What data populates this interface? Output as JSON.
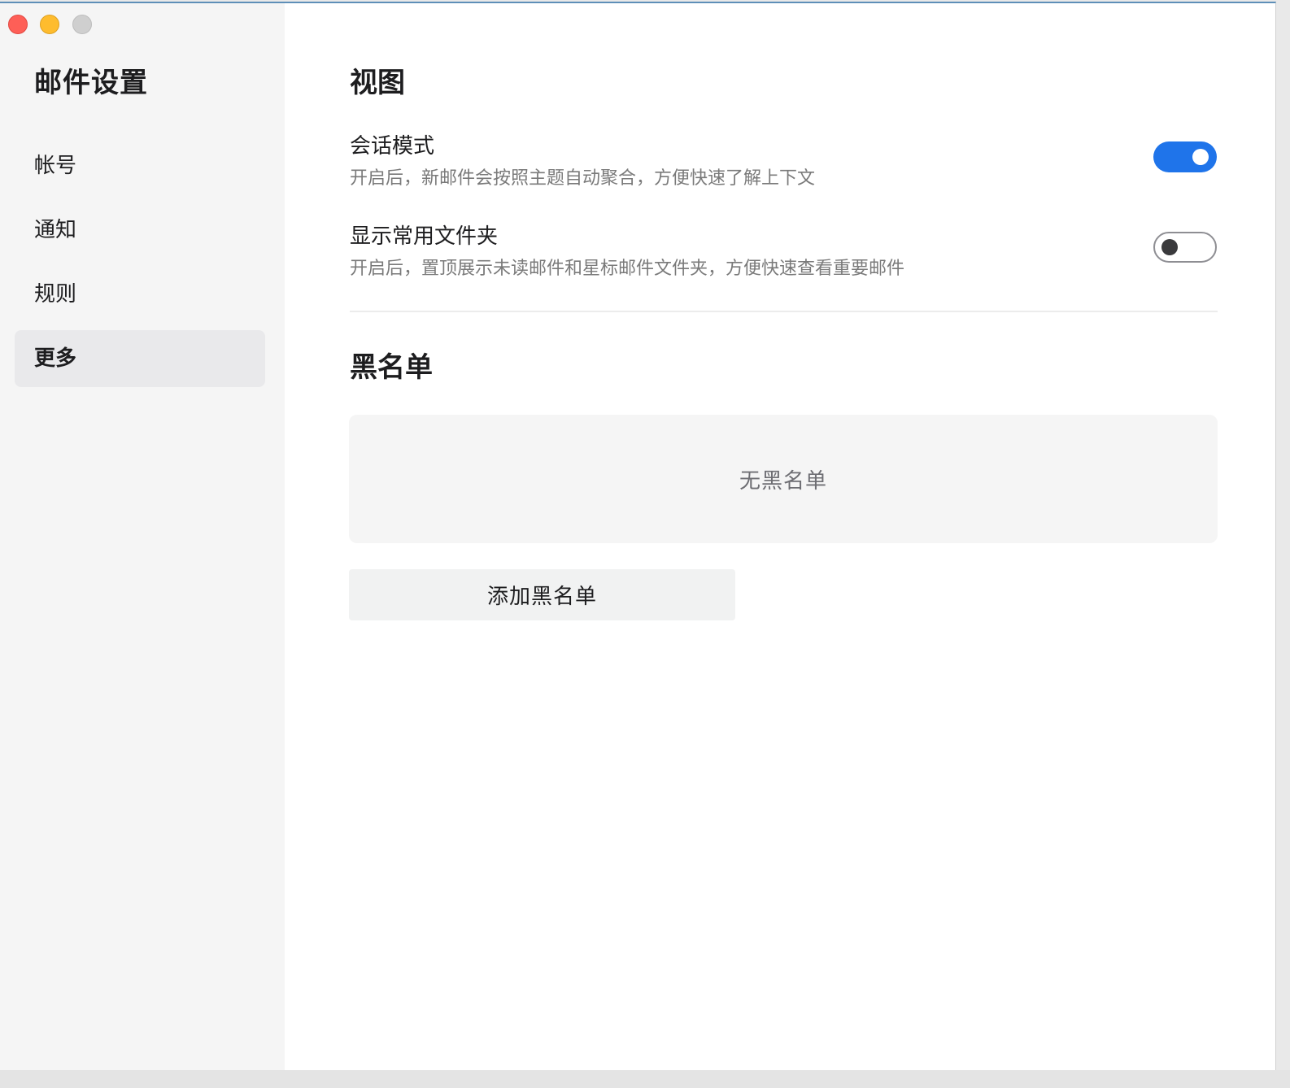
{
  "window": {
    "controls": {
      "close_icon": "red-circle",
      "minimize_icon": "yellow-circle",
      "zoom_icon": "gray-circle"
    }
  },
  "sidebar": {
    "title": "邮件设置",
    "items": [
      {
        "label": "帐号",
        "active": false
      },
      {
        "label": "通知",
        "active": false
      },
      {
        "label": "规则",
        "active": false
      },
      {
        "label": "更多",
        "active": true
      }
    ]
  },
  "main": {
    "view_section": {
      "title": "视图",
      "settings": [
        {
          "title": "会话模式",
          "description": "开启后，新邮件会按照主题自动聚合，方便快速了解上下文",
          "enabled": true
        },
        {
          "title": "显示常用文件夹",
          "description": "开启后，置顶展示未读邮件和星标邮件文件夹，方便快速查看重要邮件",
          "enabled": false
        }
      ]
    },
    "blacklist_section": {
      "title": "黑名单",
      "empty_text": "无黑名单",
      "add_button_label": "添加黑名单"
    }
  },
  "colors": {
    "accent": "#1f74ea",
    "sidebar_bg": "#f5f5f5",
    "active_item_bg": "#e9e9eb",
    "secondary_text": "#7a7a7a"
  }
}
